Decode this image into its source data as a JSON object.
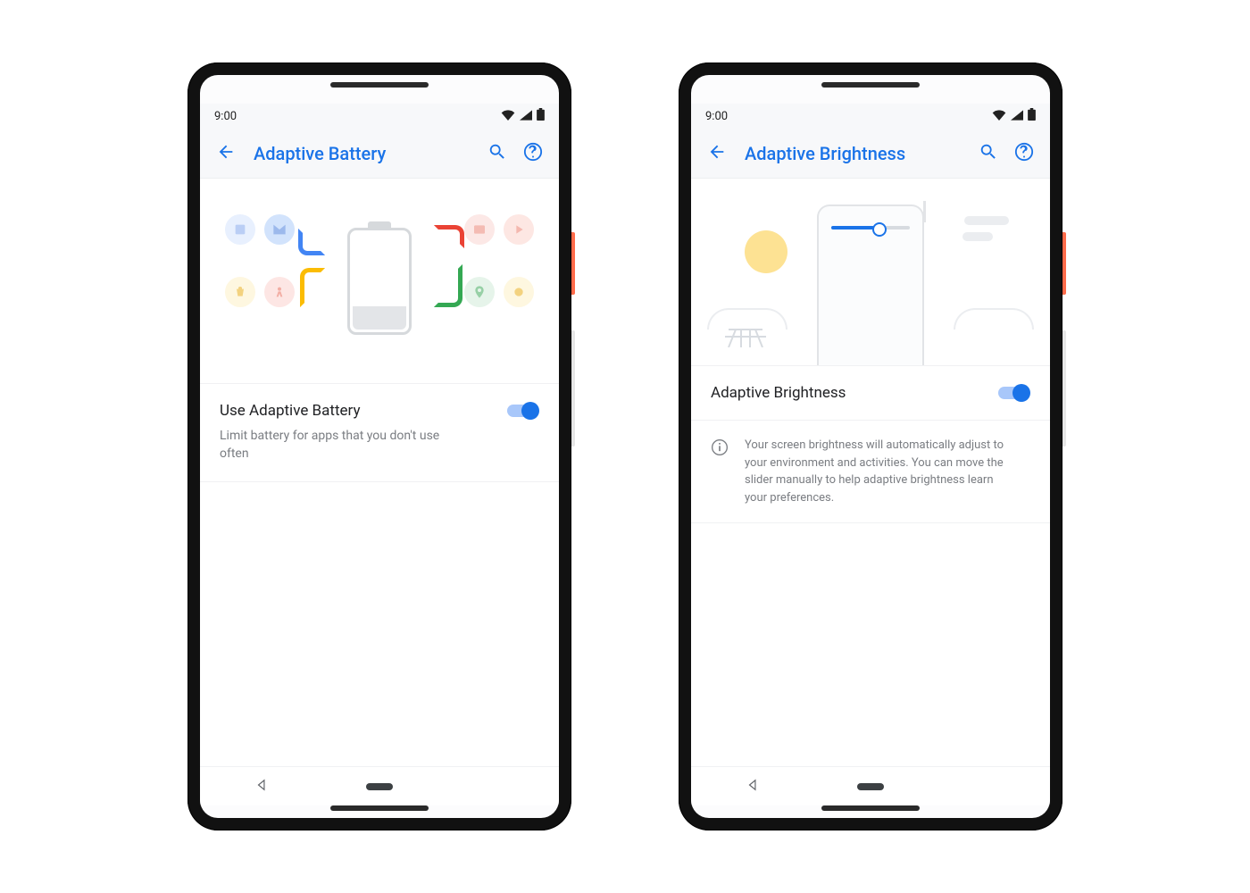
{
  "status": {
    "time": "9:00"
  },
  "colors": {
    "accent": "#1a73e8"
  },
  "phones": [
    {
      "appbar": {
        "title": "Adaptive Battery"
      },
      "setting": {
        "title": "Use Adaptive Battery",
        "subtitle": "Limit battery for apps that you don't use often",
        "toggle_on": true
      }
    },
    {
      "appbar": {
        "title": "Adaptive Brightness"
      },
      "setting": {
        "title": "Adaptive Brightness",
        "toggle_on": true
      },
      "info": "Your screen brightness will automatically adjust to your environment and activities. You can move the slider manually to help adaptive brightness learn your preferences."
    }
  ]
}
